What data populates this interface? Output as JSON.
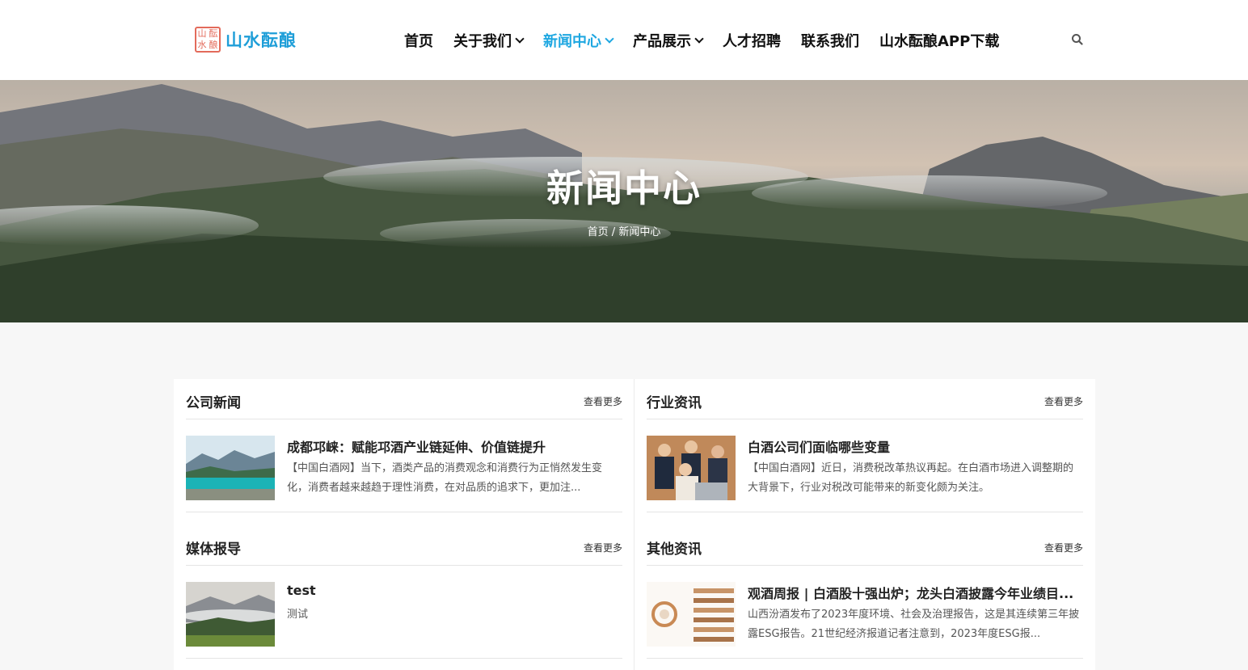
{
  "brand": {
    "seal_chars": [
      "山",
      "酝",
      "水",
      "酿"
    ],
    "name": "山水酝酿",
    "accent_color": "#1ea7e1",
    "seal_color": "#e36b5b"
  },
  "nav": [
    {
      "label": "首页",
      "has_dropdown": false,
      "active": false
    },
    {
      "label": "关于我们",
      "has_dropdown": true,
      "active": false
    },
    {
      "label": "新闻中心",
      "has_dropdown": true,
      "active": true
    },
    {
      "label": "产品展示",
      "has_dropdown": true,
      "active": false
    },
    {
      "label": "人才招聘",
      "has_dropdown": false,
      "active": false
    },
    {
      "label": "联系我们",
      "has_dropdown": false,
      "active": false
    },
    {
      "label": "山水酝酿APP下载",
      "has_dropdown": false,
      "active": false
    }
  ],
  "search_icon": "search-icon",
  "hero": {
    "title": "新闻中心",
    "breadcrumb": {
      "home": "首页",
      "separator": "/",
      "current": "新闻中心"
    }
  },
  "sections": [
    {
      "title": "公司新闻",
      "more": "查看更多",
      "article": {
        "title": "成都邛崃：赋能邛酒产业链延伸、价值链提升",
        "desc": "【中国白酒网】当下，酒类产品的消费观念和消费行为正悄然发生变化，消费者越来越趋于理性消费，在对品质的追求下，更加注...",
        "thumb": "lake-mountain"
      }
    },
    {
      "title": "行业资讯",
      "more": "查看更多",
      "article": {
        "title": "白酒公司们面临哪些变量",
        "desc": "【中国白酒网】近日，消费税改革热议再起。在白酒市场进入调整期的大背景下，行业对税改可能带来的新变化颇为关注。",
        "thumb": "business-team"
      }
    },
    {
      "title": "媒体报导",
      "more": "查看更多",
      "article": {
        "title": "test",
        "desc": "测试",
        "thumb": "misty-hills"
      }
    },
    {
      "title": "其他资讯",
      "more": "查看更多",
      "article": {
        "title": "观酒周报 | 白酒股十强出炉；龙头白酒披露今年业绩目...",
        "desc": "山西汾酒发布了2023年度环境、社会及治理报告，这是其连续第三年披露ESG报告。21世纪经济报道记者注意到，2023年度ESG报...",
        "thumb": "report-infographic"
      }
    }
  ]
}
